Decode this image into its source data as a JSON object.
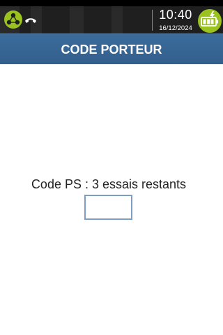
{
  "status_bar": {
    "time": "10:40",
    "date": "16/12/2024",
    "icons": {
      "network": "network-icon",
      "phone": "phone-hangup-icon",
      "battery": "battery-charging-icon"
    },
    "colors": {
      "accent_green": "#9bc31f",
      "background": "#1f1f1f"
    }
  },
  "header": {
    "title": "CODE PORTEUR",
    "color": "#3a6a9a"
  },
  "main": {
    "prompt": "Code PS : 3 essais restants",
    "pin_field": {
      "value": "",
      "border_color": "#7e9dc2"
    }
  }
}
